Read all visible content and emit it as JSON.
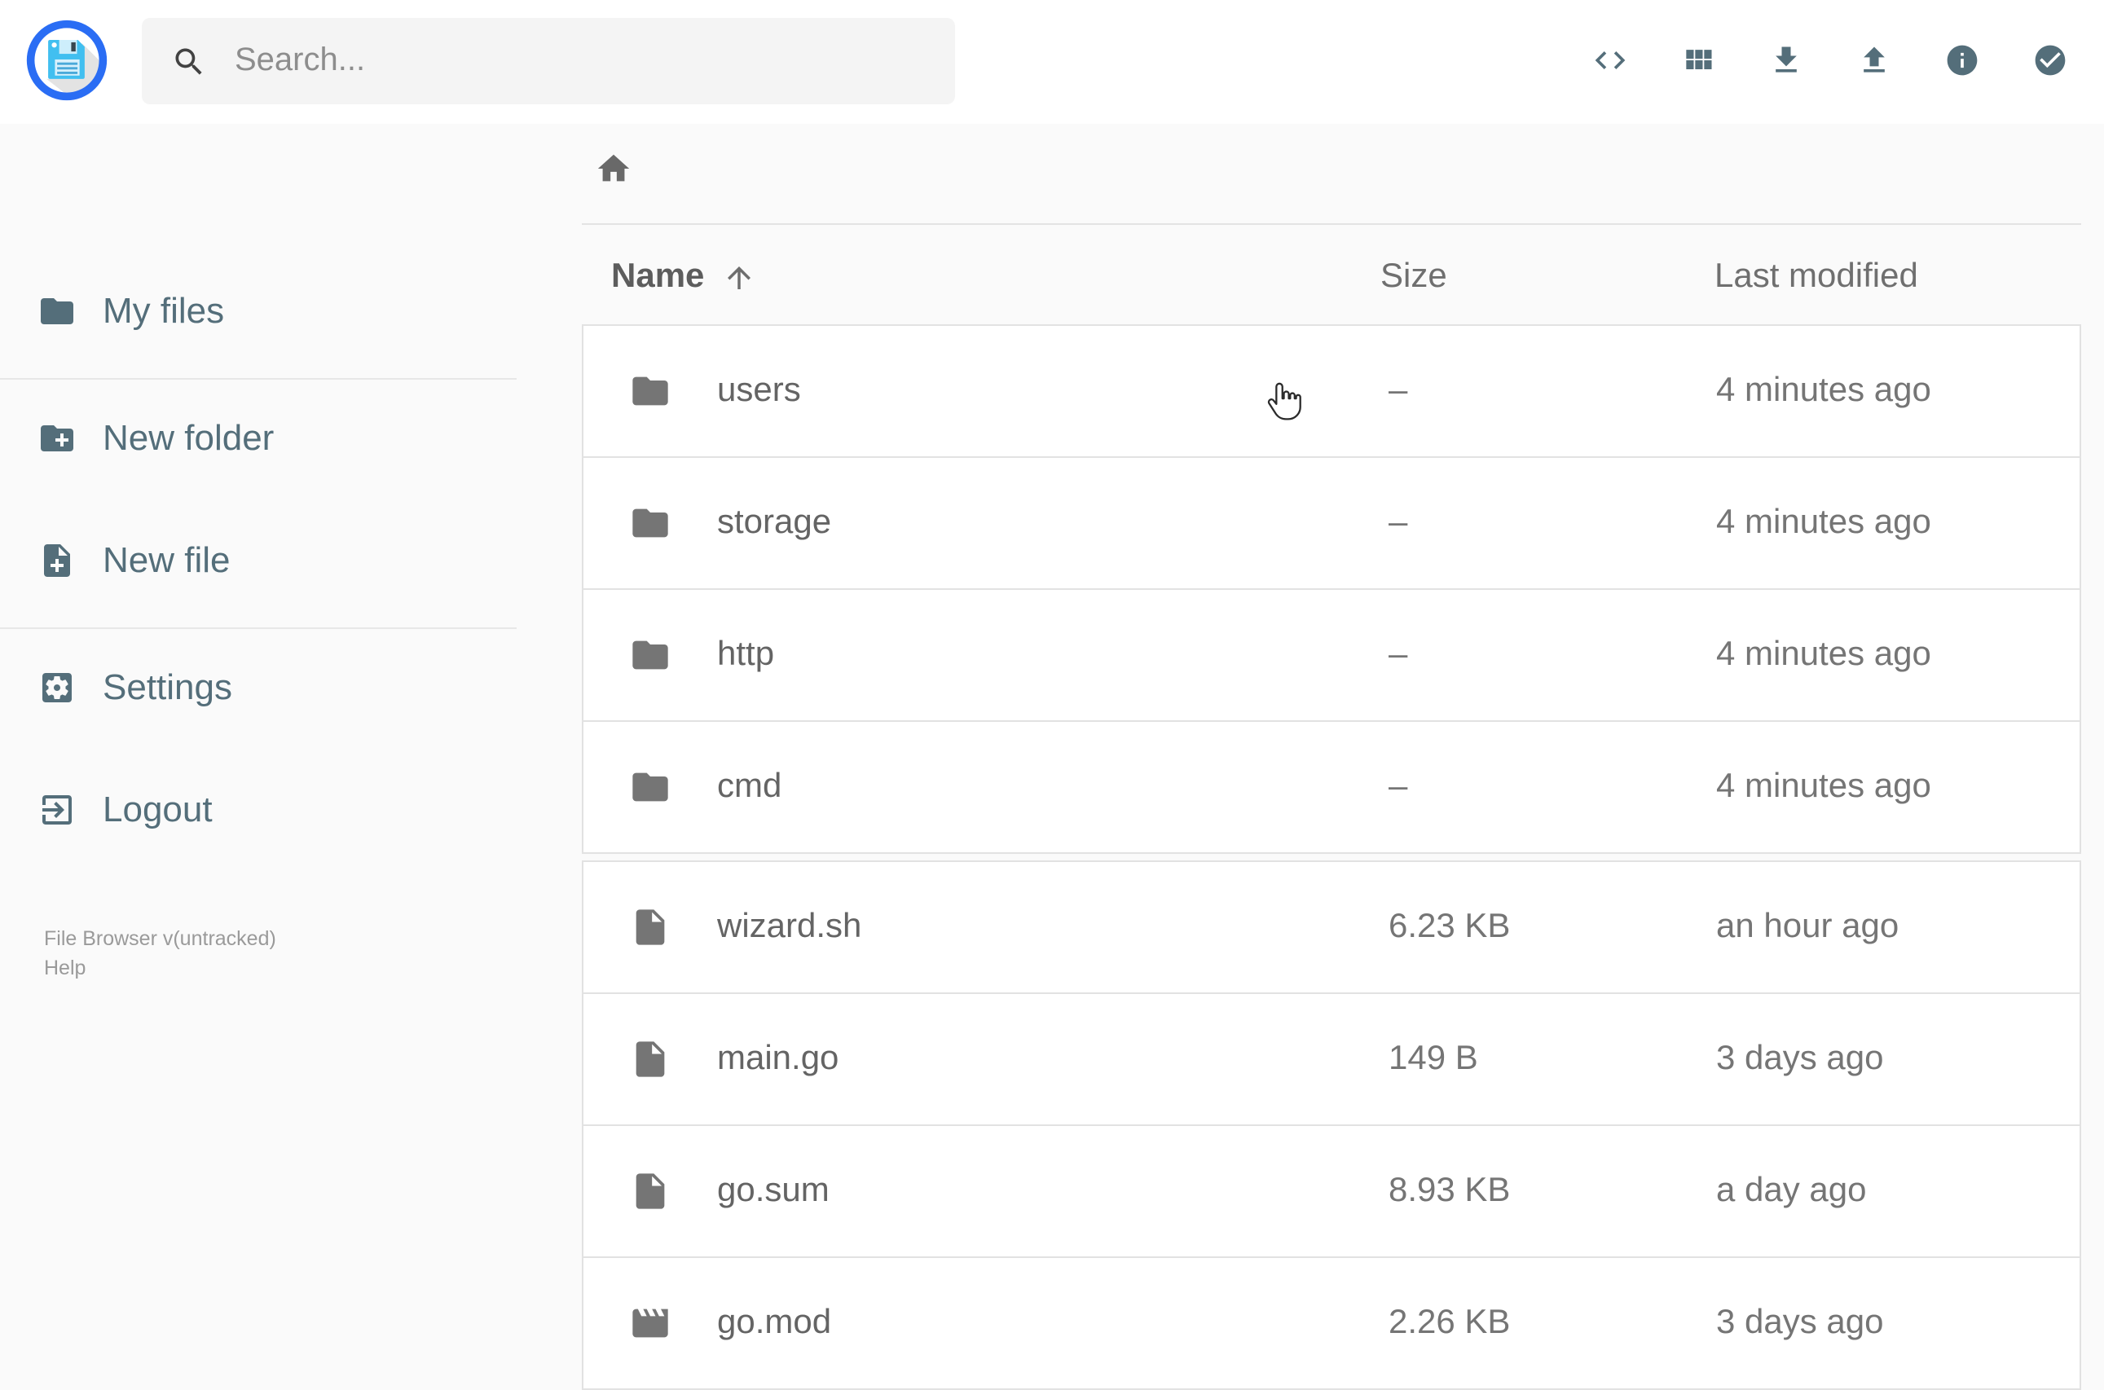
{
  "app": {
    "name": "File Browser",
    "colors": {
      "accent_slate": "#546e7a",
      "brand_blue": "#2a6df4",
      "logo_cyan": "#41bff0",
      "item_gray": "#757575",
      "page_bg": "#fafafa"
    }
  },
  "header": {
    "search": {
      "placeholder": "Search...",
      "icon": "search-icon"
    },
    "actions": [
      {
        "icon": "code-icon",
        "action": "switch-view-raw"
      },
      {
        "icon": "grid-view-icon",
        "action": "switch-view"
      },
      {
        "icon": "download-icon",
        "action": "download"
      },
      {
        "icon": "upload-icon",
        "action": "upload"
      },
      {
        "icon": "info-icon",
        "action": "info"
      },
      {
        "icon": "check-circle-icon",
        "action": "select-multiple"
      }
    ]
  },
  "sidebar": {
    "items": [
      {
        "label": "My files",
        "icon": "folder-icon"
      },
      {
        "label": "New folder",
        "icon": "new-folder-icon"
      },
      {
        "label": "New file",
        "icon": "new-file-icon"
      },
      {
        "label": "Settings",
        "icon": "settings-icon"
      },
      {
        "label": "Logout",
        "icon": "logout-icon"
      }
    ],
    "version": "File Browser v(untracked)",
    "help": "Help"
  },
  "listing": {
    "breadcrumb": {
      "icon": "home-icon"
    },
    "columns": {
      "name": "Name",
      "size": "Size",
      "modified": "Last modified"
    },
    "sort": {
      "column": "Name",
      "direction": "ascending",
      "icon": "arrow-up-icon"
    },
    "folders": [
      {
        "name": "users",
        "size": "–",
        "modified": "4 minutes ago",
        "icon": "folder-icon"
      },
      {
        "name": "storage",
        "size": "–",
        "modified": "4 minutes ago",
        "icon": "folder-icon"
      },
      {
        "name": "http",
        "size": "–",
        "modified": "4 minutes ago",
        "icon": "folder-icon"
      },
      {
        "name": "cmd",
        "size": "–",
        "modified": "4 minutes ago",
        "icon": "folder-icon"
      }
    ],
    "files": [
      {
        "name": "wizard.sh",
        "size": "6.23 KB",
        "modified": "an hour ago",
        "icon": "file-icon"
      },
      {
        "name": "main.go",
        "size": "149 B",
        "modified": "3 days ago",
        "icon": "file-icon"
      },
      {
        "name": "go.sum",
        "size": "8.93 KB",
        "modified": "a day ago",
        "icon": "file-icon"
      },
      {
        "name": "go.mod",
        "size": "2.26 KB",
        "modified": "3 days ago",
        "icon": "movie-icon"
      }
    ]
  }
}
